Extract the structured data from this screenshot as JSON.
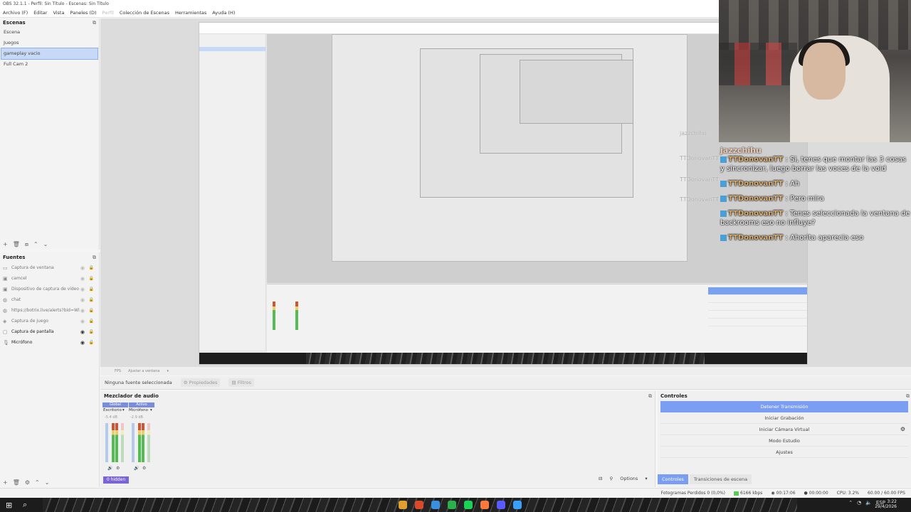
{
  "window": {
    "title": "OBS 32.1.1 - Perfil: Sin Título - Escenas: Sin Título"
  },
  "menu": [
    "Archivo (F)",
    "Editar",
    "Vista",
    "Paneles (D)",
    "Perfil",
    "Colección de Escenas",
    "Herramientas",
    "Ayuda (H)"
  ],
  "scenes": {
    "title": "Escenas",
    "items": [
      "Escena",
      "Juegos",
      "gameplay vacio",
      "Full Cam 2"
    ],
    "selected": "gameplay vacio"
  },
  "sources": {
    "title": "Fuentes",
    "items": [
      {
        "label": "Captura de ventana",
        "icon": "window-icon"
      },
      {
        "label": "camcel",
        "icon": "camera-icon"
      },
      {
        "label": "Dispositivo de captura de vídeo",
        "icon": "camera-icon"
      },
      {
        "label": "chat",
        "icon": "globe-icon"
      },
      {
        "label": "https://botrix.live/alerts?bid=Wl",
        "icon": "globe-icon"
      },
      {
        "label": "Captura de juego",
        "icon": "gamepad-icon"
      },
      {
        "label": "Captura de pantalla",
        "icon": "monitor-icon"
      },
      {
        "label": "Micrófono",
        "icon": "mic-icon"
      }
    ]
  },
  "props_bar": {
    "status": "Ninguna fuente seleccionada",
    "properties": "Propiedades",
    "filters": "Filtros"
  },
  "preview_toolbar": {
    "fps": "FPS",
    "fit": "Ajustar a ventana"
  },
  "chat": {
    "ghost_names": [
      "jazzchihu",
      "TTDonovanTT",
      "TTDonovanTT",
      "TTDonovanTT"
    ],
    "header_name": "jazzchihu",
    "lines": [
      {
        "user": "TTDonovanTT",
        "text": "Si, tenes que montar las 3 cosas y sincronizar, luego borrar las voces de la void"
      },
      {
        "user": "TTDonovanTT",
        "text": "Ah"
      },
      {
        "user": "TTDonovanTT",
        "text": "Pero mira"
      },
      {
        "user": "TTDonovanTT",
        "text": "Tenes seleccionada la ventana de backrooms eso no influye?"
      },
      {
        "user": "TTDonovanTT",
        "text": "Ahorita aparecia eso"
      }
    ]
  },
  "mixer": {
    "title": "Mezclador de audio",
    "tabs": [
      "Global",
      "Activo"
    ],
    "channels": [
      {
        "name": "Escritorio",
        "db": "-5.4 dB"
      },
      {
        "name": "Micrófono",
        "db": "-2.9 dB"
      }
    ],
    "hidden_badge": "0 hidden",
    "options": "Options"
  },
  "controls": {
    "title": "Controles",
    "buttons": [
      "Detener Transmisión",
      "Iniciar Grabación",
      "Iniciar Cámara Virtual",
      "Modo Estudio",
      "Ajustes"
    ]
  },
  "bottom_tabs": [
    "Controles",
    "Transiciones de escena"
  ],
  "status": {
    "dropped": "Fotogramas Perdidos 0 (0,0%)",
    "bitrate": "6166 kbps",
    "live": "00:17:06",
    "rec": "00:00:00",
    "cpu": "CPU: 3.2%",
    "fps": "60.00 / 60.00 FPS"
  },
  "taskbar": {
    "lang": "ESP",
    "time": "3:22",
    "date": "29/4/2026",
    "app_colors": [
      "#e0a030",
      "#d84a2a",
      "#3a8fe0",
      "#2bb14c",
      "#19d256",
      "#ff7a3a",
      "#5a5aff",
      "#3aa0ff"
    ]
  }
}
